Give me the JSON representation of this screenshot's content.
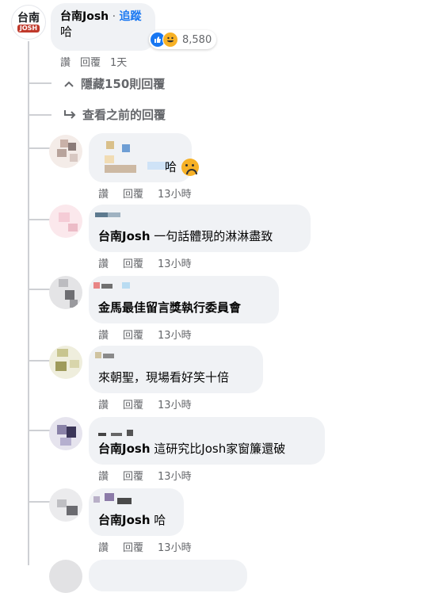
{
  "top_comment": {
    "author": "台南Josh",
    "separator": " · ",
    "follow": "追蹤",
    "text": "哈",
    "reaction_count": "8,580",
    "actions": {
      "like": "讚",
      "reply": "回覆",
      "time": "1天"
    },
    "avatar_logo_top": "台南",
    "avatar_logo_bottom": "JOSH"
  },
  "hidden_replies": "隱藏150則回覆",
  "view_previous": "查看之前的回覆",
  "replies": [
    {
      "text": "哈",
      "tag": "",
      "actions": {
        "like": "讚",
        "reply": "回覆",
        "time": "13小時"
      }
    },
    {
      "tag": "台南Josh",
      "text": "一句話體現的淋淋盡致",
      "actions": {
        "like": "讚",
        "reply": "回覆",
        "time": "13小時"
      }
    },
    {
      "tag": "",
      "text": "金馬最佳留言獎執行委員會",
      "actions": {
        "like": "讚",
        "reply": "回覆",
        "time": "13小時"
      }
    },
    {
      "tag": "",
      "text": "來朝聖，現場看好笑十倍",
      "actions": {
        "like": "讚",
        "reply": "回覆",
        "time": "13小時"
      }
    },
    {
      "tag": "台南Josh",
      "text": "這研究比Josh家窗簾還破",
      "actions": {
        "like": "讚",
        "reply": "回覆",
        "time": "13小時"
      }
    },
    {
      "tag": "台南Josh",
      "text": "哈",
      "actions": {
        "like": "讚",
        "reply": "回覆",
        "time": "13小時"
      }
    }
  ],
  "colors": {
    "bubble": "#f0f2f5",
    "meta": "#65676b",
    "link": "#1877f2"
  },
  "icons": {
    "hidden_replies": "chevron-up-icon",
    "view_previous": "reply-arrow-icon",
    "like": "thumbs-up-icon",
    "haha": "haha-icon",
    "sad": "sad-emoji-icon"
  }
}
